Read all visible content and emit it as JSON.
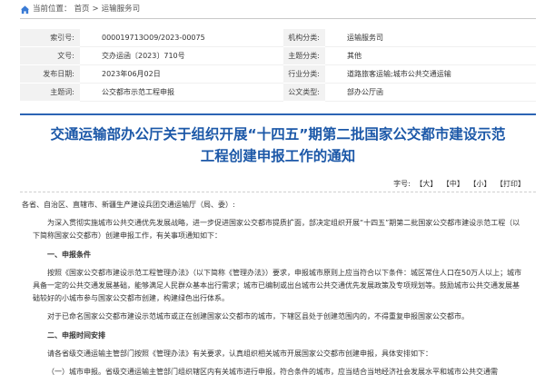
{
  "breadcrumb": {
    "current_label": "当前位置：",
    "home": "首页",
    "sep": ">",
    "section": "运输服务司"
  },
  "meta": {
    "rows": [
      {
        "k1": "索引号:",
        "v1": "000019713O09/2023-00075",
        "k2": "机构分类:",
        "v2": "运输服务司"
      },
      {
        "k1": "文号:",
        "v1": "交办运函〔2023〕710号",
        "k2": "主题分类:",
        "v2": "其他"
      },
      {
        "k1": "发布日期:",
        "v1": "2023年06月02日",
        "k2": "行业分类:",
        "v2": "道路旅客运输;城市公共交通运输"
      },
      {
        "k1": "主题词:",
        "v1": "公交都市示范工程申报",
        "k2": "公文类型:",
        "v2": "部办公厅函"
      }
    ]
  },
  "title": {
    "line1": "交通运输部办公厅关于组织开展“十四五”期第二批国家公交都市建设示范",
    "line2": "工程创建申报工作的通知"
  },
  "font_bar": {
    "label": "字号:",
    "large": "【大】",
    "medium": "【中】",
    "small": "【小】",
    "print": "【打印】"
  },
  "body": {
    "addressee": "各省、自治区、直辖市、新疆生产建设兵团交通运输厅（局、委）:",
    "intro": "为深入贯彻实施城市公共交通优先发展战略，进一步促进国家公交都市提质扩面，部决定组织开展“十四五”期第二批国家公交都市建设示范工程（以下简称国家公交都市）创建申报工作，有关事项通知如下：",
    "sec1": "一、申报条件",
    "p1": "按照《国家公交都市建设示范工程管理办法》（以下简称《管理办法》）要求，申报城市原则上应当符合以下条件：城区常住人口在50万人以上；城市具备一定的公共交通发展基础，能够满足人民群众基本出行需求；城市已编制或出台城市公共交通优先发展政策及专项规划等。鼓励城市公共交通发展基础较好的小城市参与国家公交都市创建，构建绿色出行体系。",
    "p2": "对于已命名国家公交都市建设示范城市或正在创建国家公交都市的城市，下辖区县处于创建范围内的，不得重复申报国家公交都市。",
    "sec2": "二、申报时间安排",
    "p3": "请各省级交通运输主管部门按照《管理办法》有关要求，认真组织相关城市开展国家公交都市创建申报，具体安排如下：",
    "p4": "（一）城市申报。省级交通运输主管部门组织辖区内有关城市进行申报，符合条件的城市，应当结合当地经济社会发展水平和城市公共交通需"
  }
}
